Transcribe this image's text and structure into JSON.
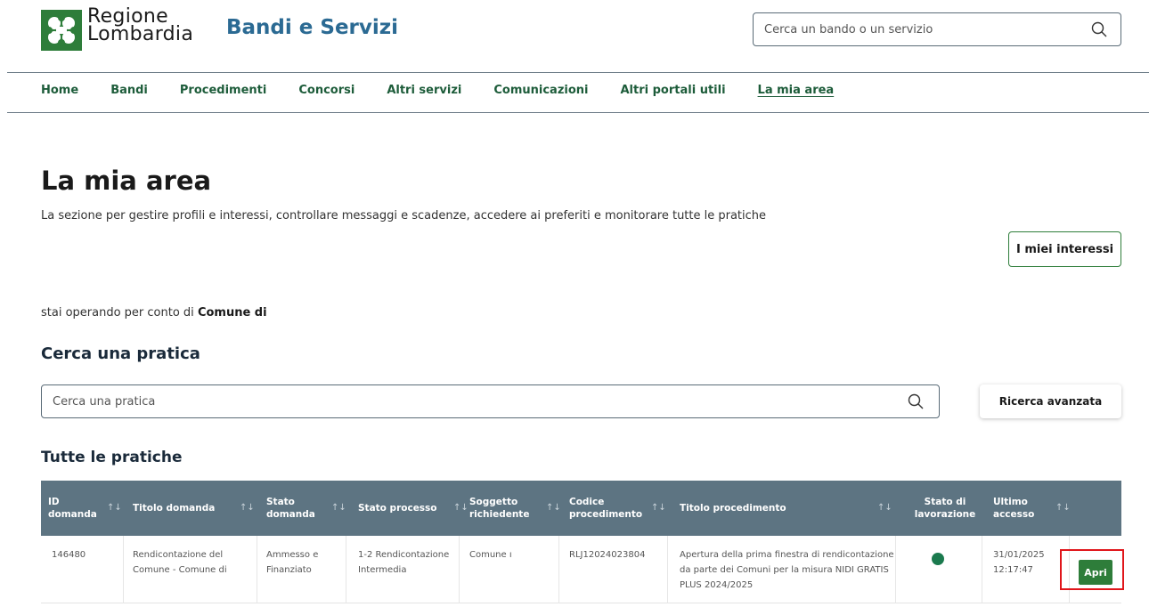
{
  "header": {
    "logo_line1": "Regione",
    "logo_line2": "Lombardia",
    "site_title": "Bandi e Servizi",
    "search_placeholder": "Cerca un bando o un servizio",
    "logo_color": "#2e7d3a"
  },
  "nav": {
    "items": [
      {
        "label": "Home"
      },
      {
        "label": "Bandi"
      },
      {
        "label": "Procedimenti"
      },
      {
        "label": "Concorsi"
      },
      {
        "label": "Altri servizi"
      },
      {
        "label": "Comunicazioni"
      },
      {
        "label": "Altri portali utili"
      },
      {
        "label": "La mia area",
        "active": true
      }
    ]
  },
  "page": {
    "title": "La mia area",
    "subtitle": "La sezione per gestire profili e interessi, controllare messaggi e scadenze, accedere ai preferiti e monitorare tutte le pratiche",
    "interests_button": "I miei interessi",
    "operating_prefix": "stai operando per conto di",
    "operating_entity": "Comune di"
  },
  "search_practice": {
    "title": "Cerca una pratica",
    "placeholder": "Cerca una pratica",
    "advanced_button": "Ricerca avanzata"
  },
  "table": {
    "title": "Tutte le pratiche",
    "header_color": "#5d7482",
    "columns": [
      {
        "line1": "ID",
        "line2": "domanda"
      },
      {
        "line1": "Titolo domanda",
        "line2": ""
      },
      {
        "line1": "Stato",
        "line2": "domanda"
      },
      {
        "line1": "Stato processo",
        "line2": ""
      },
      {
        "line1": "Soggetto",
        "line2": "richiedente"
      },
      {
        "line1": "Codice",
        "line2": "procedimento"
      },
      {
        "line1": "Titolo procedimento",
        "line2": ""
      },
      {
        "line1": "Stato di",
        "line2": "lavorazione"
      },
      {
        "line1": "Ultimo",
        "line2": "accesso"
      }
    ],
    "rows": [
      {
        "id": "146480",
        "titolo_domanda_1": "Rendicontazione del",
        "titolo_domanda_2": "Comune - Comune di",
        "stato_domanda_1": "Ammesso e",
        "stato_domanda_2": "Finanziato",
        "stato_processo_1": "1-2 Rendicontazione",
        "stato_processo_2": "Intermedia",
        "soggetto": "Comune ı",
        "codice": "RLJ12024023804",
        "titolo_proc_1": "Apertura della prima finestra di rendicontazione",
        "titolo_proc_2": "da parte dei Comuni per la misura NIDI GRATIS",
        "titolo_proc_3": "PLUS 2024/2025",
        "stato_lavorazione_color": "#1b7a4e",
        "ultimo_accesso_1": "31/01/2025",
        "ultimo_accesso_2": "12:17:47",
        "action": "Apri"
      }
    ]
  }
}
